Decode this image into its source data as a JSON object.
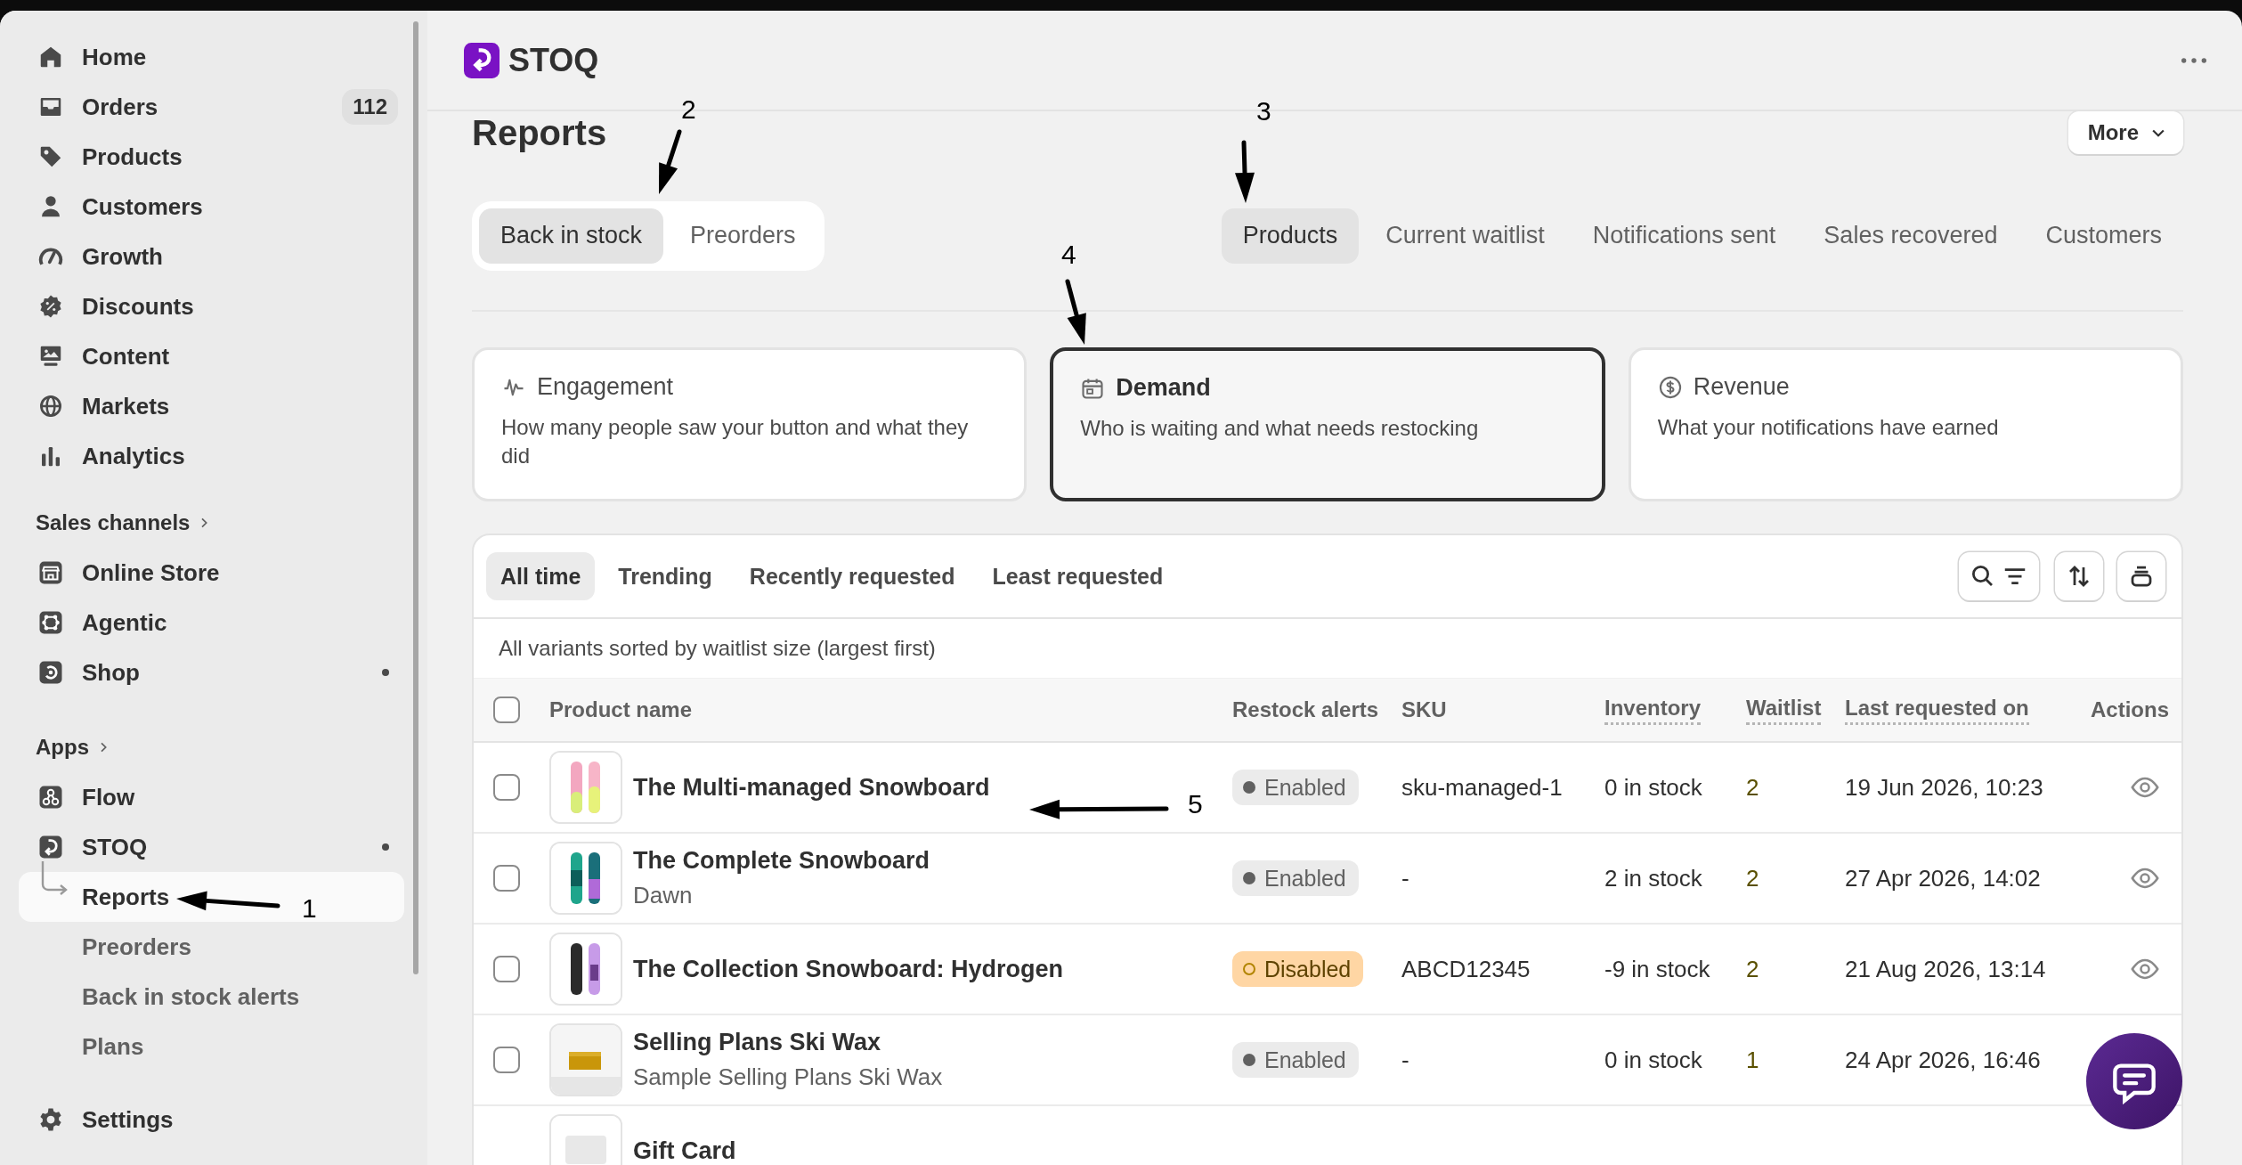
{
  "sidebar": {
    "main_items": [
      {
        "label": "Home"
      },
      {
        "label": "Orders",
        "badge": "112"
      },
      {
        "label": "Products"
      },
      {
        "label": "Customers"
      },
      {
        "label": "Growth"
      },
      {
        "label": "Discounts"
      },
      {
        "label": "Content"
      },
      {
        "label": "Markets"
      },
      {
        "label": "Analytics"
      }
    ],
    "sections": [
      {
        "title": "Sales channels",
        "items": [
          {
            "label": "Online Store",
            "dot": false
          },
          {
            "label": "Agentic",
            "dot": false
          },
          {
            "label": "Shop",
            "dot": true
          }
        ]
      },
      {
        "title": "Apps",
        "items": [
          {
            "label": "Flow",
            "dot": false
          },
          {
            "label": "STOQ",
            "dot": true,
            "children": [
              {
                "label": "Reports",
                "selected": true
              },
              {
                "label": "Preorders",
                "selected": false
              },
              {
                "label": "Back in stock alerts",
                "selected": false
              },
              {
                "label": "Plans",
                "selected": false
              }
            ]
          }
        ]
      }
    ],
    "settings": "Settings"
  },
  "header": {
    "app_name": "STOQ"
  },
  "page": {
    "title": "Reports",
    "more_button": "More",
    "mode_tabs": [
      {
        "label": "Back in stock",
        "selected": true
      },
      {
        "label": "Preorders",
        "selected": false
      }
    ],
    "section_tabs": [
      {
        "label": "Products",
        "selected": true
      },
      {
        "label": "Current waitlist",
        "selected": false
      },
      {
        "label": "Notifications sent",
        "selected": false
      },
      {
        "label": "Sales recovered",
        "selected": false
      },
      {
        "label": "Customers",
        "selected": false
      }
    ],
    "report_cards": [
      {
        "title": "Engagement",
        "description": "How many people saw your button and what they did",
        "selected": false
      },
      {
        "title": "Demand",
        "description": "Who is waiting and what needs restocking",
        "selected": true
      },
      {
        "title": "Revenue",
        "description": "What your notifications have earned",
        "selected": false
      }
    ]
  },
  "table": {
    "filter_tabs": [
      {
        "label": "All time",
        "selected": true
      },
      {
        "label": "Trending",
        "selected": false
      },
      {
        "label": "Recently requested",
        "selected": false
      },
      {
        "label": "Least requested",
        "selected": false
      }
    ],
    "subtitle": "All variants sorted by waitlist size (largest first)",
    "header_checked": false,
    "columns": [
      {
        "label": "Product name",
        "underlined": false
      },
      {
        "label": "Restock alerts",
        "underlined": false
      },
      {
        "label": "SKU",
        "underlined": false
      },
      {
        "label": "Inventory",
        "underlined": true
      },
      {
        "label": "Waitlist",
        "underlined": true
      },
      {
        "label": "Last requested on",
        "underlined": true
      },
      {
        "label": "Actions",
        "underlined": false
      }
    ],
    "rows": [
      {
        "checked": false,
        "name": "The Multi-managed Snowboard",
        "alert": {
          "label": "Enabled",
          "kind": "enabled"
        },
        "sku": "sku-managed-1",
        "inventory": "0 in stock",
        "waitlist": "2",
        "last_requested": "19 Jun 2026, 10:23",
        "view": true
      },
      {
        "checked": false,
        "name": "The Complete Snowboard",
        "variant": "Dawn",
        "alert": {
          "label": "Enabled",
          "kind": "enabled"
        },
        "sku": "-",
        "inventory": "2 in stock",
        "waitlist": "2",
        "last_requested": "27 Apr 2026, 14:02",
        "view": true
      },
      {
        "checked": false,
        "name": "The Collection Snowboard: Hydrogen",
        "alert": {
          "label": "Disabled",
          "kind": "disabled"
        },
        "sku": "ABCD12345",
        "inventory": "-9 in stock",
        "waitlist": "2",
        "last_requested": "21 Aug 2026, 13:14",
        "view": true
      },
      {
        "checked": false,
        "name": "Selling Plans Ski Wax",
        "variant": "Sample Selling Plans Ski Wax",
        "alert": {
          "label": "Enabled",
          "kind": "enabled"
        },
        "sku": "-",
        "inventory": "0 in stock",
        "waitlist": "1",
        "last_requested": "24 Apr 2026, 16:46"
      },
      {
        "name": "Gift Card"
      }
    ]
  },
  "annotations": [
    {
      "label": "1"
    },
    {
      "label": "2"
    },
    {
      "label": "3"
    },
    {
      "label": "4"
    },
    {
      "label": "5"
    }
  ]
}
